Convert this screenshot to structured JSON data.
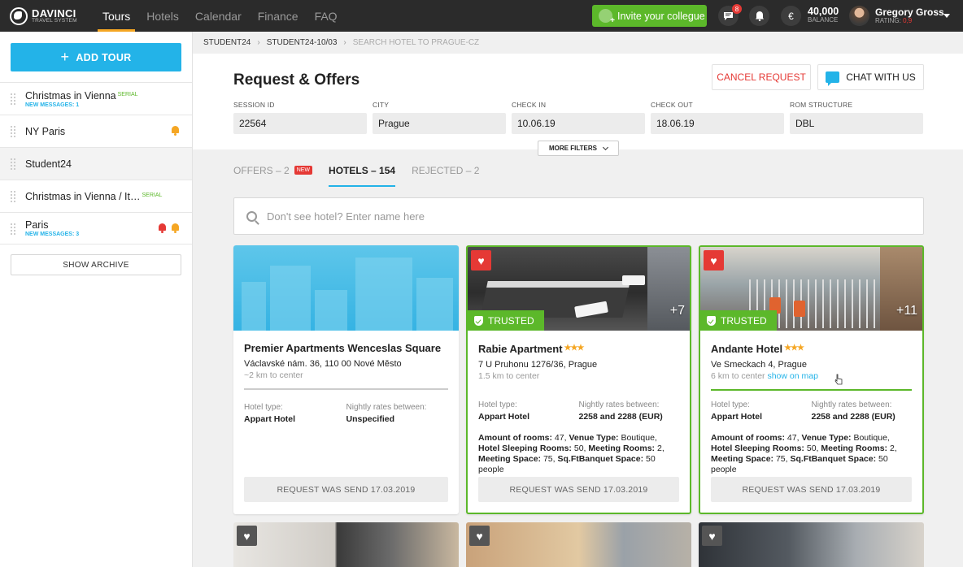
{
  "app": {
    "logo_title": "DAVINCI",
    "logo_subtitle": "TRAVEL SYSTEM"
  },
  "nav": [
    {
      "label": "Tours",
      "active": true
    },
    {
      "label": "Hotels",
      "active": false
    },
    {
      "label": "Calendar",
      "active": false
    },
    {
      "label": "Finance",
      "active": false
    },
    {
      "label": "FAQ",
      "active": false
    }
  ],
  "topbar": {
    "invite_label": "Invite your collegue",
    "messages_count": "8",
    "balance_value": "40,000",
    "balance_label": "BALANCE",
    "currency_symbol": "€",
    "user_name": "Gregory Gross",
    "rating_label": "RATING:",
    "rating_value": "0,9"
  },
  "sidebar": {
    "add_tour_label": "ADD TOUR",
    "tours": [
      {
        "title": "Christmas in Vienna",
        "tag": "SERIAL",
        "messages": "NEW MESSAGES: 1"
      },
      {
        "title": "NY Paris",
        "tag": "",
        "messages": ""
      },
      {
        "title": "Student24",
        "tag": "",
        "messages": ""
      },
      {
        "title": "Christmas in Vienna / It…",
        "tag": "SERIAL",
        "messages": ""
      },
      {
        "title": "Paris",
        "tag": "",
        "messages": "NEW MESSAGES: 3"
      }
    ],
    "show_archive_label": "SHOW ARCHIVE"
  },
  "breadcrumb": [
    "STUDENT24",
    "STUDENT24-10/03",
    "SEARCH HOTEL TO PRAGUE-CZ"
  ],
  "header": {
    "title": "Request & Offers",
    "cancel_label": "CANCEL REQUEST",
    "chat_label": "CHAT WITH US",
    "fields": [
      {
        "label": "SESSION ID",
        "value": "22564"
      },
      {
        "label": "CITY",
        "value": "Prague"
      },
      {
        "label": "CHECK IN",
        "value": "10.06.19"
      },
      {
        "label": "CHECK OUT",
        "value": "18.06.19"
      },
      {
        "label": "ROM STRUCTURE",
        "value": "DBL"
      }
    ],
    "more_filters_label": "MORE FILTERS"
  },
  "tabs": [
    {
      "label": "OFFERS – 2",
      "badge": "NEW"
    },
    {
      "label": "HOTELS – 154",
      "badge": ""
    },
    {
      "label": "REJECTED – 2",
      "badge": ""
    }
  ],
  "search": {
    "placeholder": "Don't see hotel? Enter name here"
  },
  "hotels": [
    {
      "name": "Premier Apartments Wenceslas Square",
      "stars": "",
      "address": "Václavské nám. 36, 110 00 Nové Město",
      "distance": "~2 km to center",
      "map_link": "",
      "trusted": "",
      "photos_more": "",
      "type_label": "Hotel type:",
      "type_value": "Appart Hotel",
      "rates_label": "Nightly rates between:",
      "rates_value": "Unspecified",
      "amenities": null,
      "request_label": "REQUEST WAS SEND 17.03.2019"
    },
    {
      "name": "Rabie Apartment",
      "stars": "★★★",
      "address": "7 U Pruhonu 1276/36, Prague",
      "distance": "1.5 km to center",
      "map_link": "",
      "trusted": "TRUSTED",
      "photos_more": "+7",
      "type_label": "Hotel type:",
      "type_value": "Appart Hotel",
      "rates_label": "Nightly rates between:",
      "rates_value": "2258 and 2288 (EUR)",
      "amenities": {
        "rooms_label": "Amount of rooms:",
        "rooms": "47",
        "venue_label": "Venue Type:",
        "venue": "Boutique,",
        "hotel_label": "Hotel",
        "sleeping_label": "Sleeping Rooms:",
        "sleeping": "50,",
        "meeting_label": "Meeting Rooms:",
        "meeting": "2,",
        "meeting_space_label": "Meeting",
        "space_label": "Space:",
        "space": "75,",
        "banquet_label": "Sq.FtBanquet Space:",
        "banquet": "50 people"
      },
      "request_label": "REQUEST WAS SEND 17.03.2019"
    },
    {
      "name": "Andante Hotel",
      "stars": "★★★",
      "address": "Ve Smeckach 4, Prague",
      "distance": "6 km to center",
      "map_link": "show on map",
      "trusted": "TRUSTED",
      "photos_more": "+11",
      "type_label": "Hotel type:",
      "type_value": "Appart Hotel",
      "rates_label": "Nightly rates between:",
      "rates_value": "2258 and 2288 (EUR)",
      "amenities": {
        "rooms_label": "Amount of rooms:",
        "rooms": "47",
        "venue_label": "Venue Type:",
        "venue": "Boutique,",
        "hotel_label": "Hotel",
        "sleeping_label": "Sleeping Rooms:",
        "sleeping": "50,",
        "meeting_label": "Meeting Rooms:",
        "meeting": "2,",
        "meeting_space_label": "Meeting",
        "space_label": "Space:",
        "space": "75,",
        "banquet_label": "Sq.FtBanquet Space:",
        "banquet": "50 people"
      },
      "request_label": "REQUEST WAS SEND 17.03.2019"
    }
  ],
  "colors": {
    "accent_blue": "#23b3e8",
    "trusted_green": "#5cb82a",
    "alert_red": "#e53935",
    "nav_underline": "#f5a623"
  },
  "icons": {
    "globe": "logo-globe-icon",
    "user_plus": "user-plus-icon",
    "messages": "chat-bubble-icon",
    "bell": "bell-icon",
    "euro": "euro-icon",
    "heart": "heart-icon",
    "shield": "shield-check-icon",
    "search": "search-icon"
  }
}
